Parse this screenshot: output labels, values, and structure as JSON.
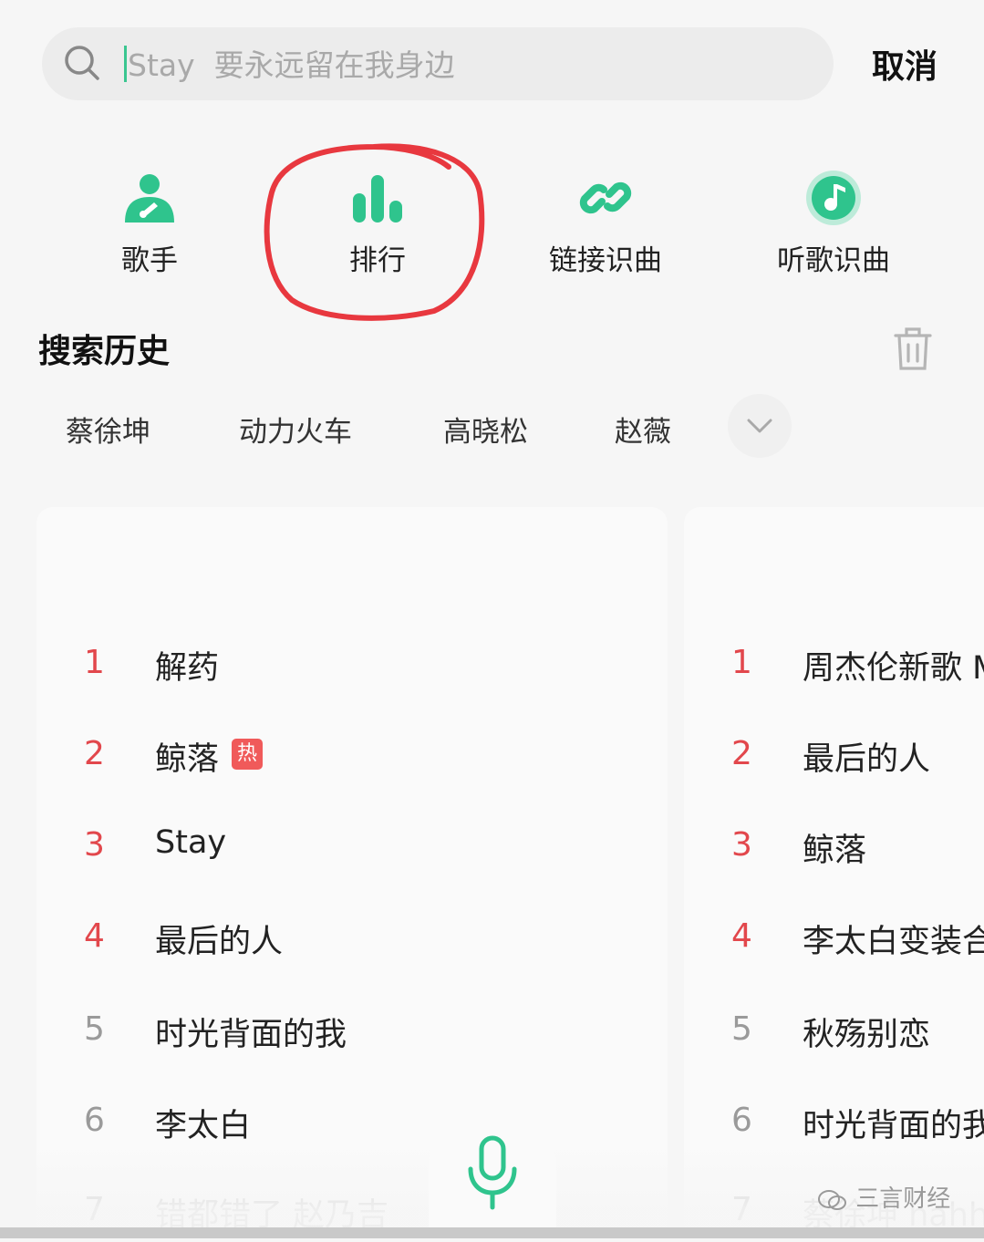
{
  "search": {
    "placeholder": "Stay  要永远留在我身边",
    "cancel_label": "取消"
  },
  "quick_entries": [
    {
      "label": "歌手",
      "icon": "singer-icon"
    },
    {
      "label": "排行",
      "icon": "ranking-icon"
    },
    {
      "label": "链接识曲",
      "icon": "link-icon"
    },
    {
      "label": "听歌识曲",
      "icon": "music-recognize-icon"
    }
  ],
  "colors": {
    "accent": "#2fc48d",
    "rank_red": "#e2474c",
    "annotation_red": "#e8383f",
    "hot_badge": "#f05a5a"
  },
  "history": {
    "title": "搜索历史",
    "tags": [
      "蔡徐坤",
      "动力火车",
      "高晓松",
      "赵薇"
    ]
  },
  "ranking_left": {
    "items": [
      {
        "rank": "1",
        "title": "解药"
      },
      {
        "rank": "2",
        "title": "鲸落",
        "badge": "热"
      },
      {
        "rank": "3",
        "title": "Stay"
      },
      {
        "rank": "4",
        "title": "最后的人"
      },
      {
        "rank": "5",
        "title": "时光背面的我"
      },
      {
        "rank": "6",
        "title": "李太白"
      },
      {
        "rank": "7",
        "title": "错都错了 赵乃吉"
      }
    ]
  },
  "ranking_right": {
    "items": [
      {
        "rank": "1",
        "title": "周杰伦新歌 M"
      },
      {
        "rank": "2",
        "title": "最后的人"
      },
      {
        "rank": "3",
        "title": "鲸落"
      },
      {
        "rank": "4",
        "title": "李太白变装合"
      },
      {
        "rank": "5",
        "title": "秋殇别恋"
      },
      {
        "rank": "6",
        "title": "时光背面的我"
      },
      {
        "rank": "7",
        "title": "蔡徐坤 hahha"
      }
    ]
  },
  "watermark": "三言财经"
}
